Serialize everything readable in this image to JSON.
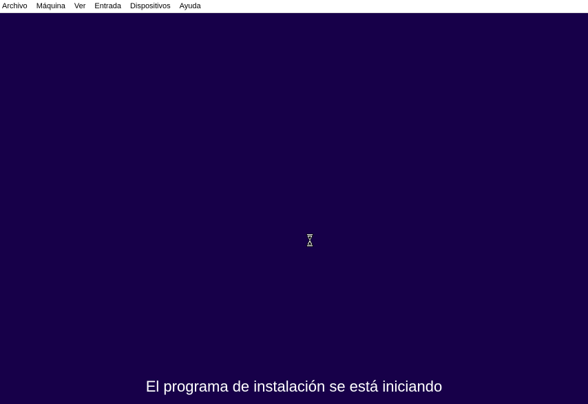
{
  "menubar": {
    "items": [
      {
        "label": "Archivo"
      },
      {
        "label": "Máquina"
      },
      {
        "label": "Ver"
      },
      {
        "label": "Entrada"
      },
      {
        "label": "Dispositivos"
      },
      {
        "label": "Ayuda"
      }
    ]
  },
  "screen": {
    "background": "#170049",
    "cursor_icon": "hourglass-icon",
    "status_text": "El programa de instalación se está iniciando"
  }
}
